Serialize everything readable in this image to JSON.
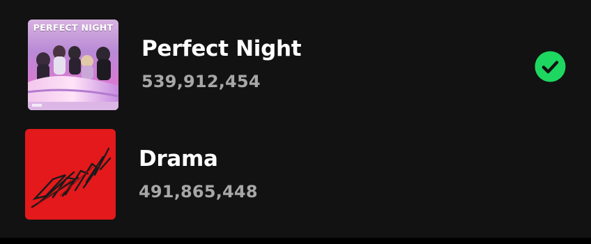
{
  "colors": {
    "background": "#121212",
    "primary_text": "#ffffff",
    "secondary_text": "#a7a7a7",
    "accent_green": "#1ed760",
    "drama_cover_red": "#e3191c"
  },
  "tracks": [
    {
      "title": "Perfect Night",
      "plays": "539,912,454",
      "cover_text": "PERFECT NIGHT",
      "saved": true,
      "saved_icon": "check-circle-icon"
    },
    {
      "title": "Drama",
      "plays": "491,865,448",
      "saved": false
    }
  ]
}
